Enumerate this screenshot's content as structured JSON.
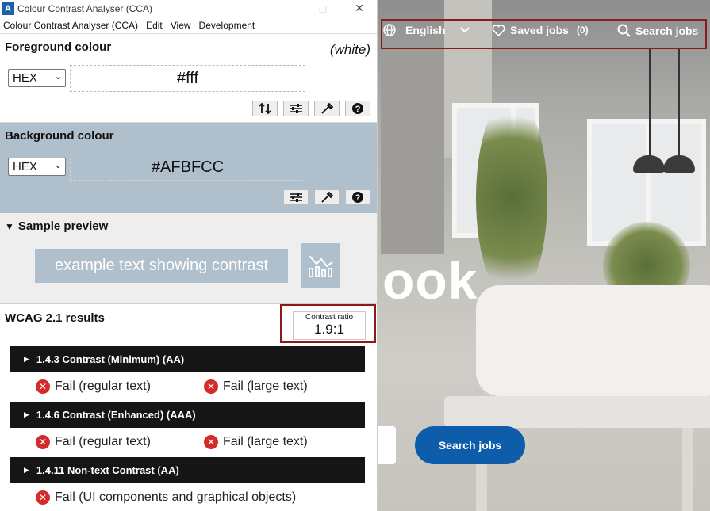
{
  "cca": {
    "title": "Colour Contrast Analyser (CCA)",
    "menu": [
      "Colour Contrast Analyser (CCA)",
      "Edit",
      "View",
      "Development"
    ],
    "foreground": {
      "title": "Foreground colour",
      "note": "(white)",
      "format": "HEX",
      "value": "#fff",
      "color": "#ffffff"
    },
    "background": {
      "title": "Background colour",
      "format": "HEX",
      "value": "#AFBFCC",
      "color": "#afbfcc"
    },
    "preview": {
      "title": "Sample preview",
      "sample_text": "example text showing contrast"
    },
    "wcag": {
      "title": "WCAG 2.1 results",
      "ratio_label": "Contrast ratio",
      "ratio_value": "1.9:1",
      "criteria": [
        {
          "label": "1.4.3 Contrast (Minimum) (AA)",
          "results": [
            "Fail (regular text)",
            "Fail (large text)"
          ]
        },
        {
          "label": "1.4.6 Contrast (Enhanced) (AAA)",
          "results": [
            "Fail (regular text)",
            "Fail (large text)"
          ]
        },
        {
          "label": "1.4.11 Non-text Contrast (AA)",
          "results": [
            "Fail (UI components and graphical objects)"
          ]
        }
      ]
    }
  },
  "site": {
    "language": "English",
    "saved_jobs": "Saved jobs",
    "saved_count": "(0)",
    "search_jobs": "Search jobs",
    "hero_text": "ook",
    "search_button": "Search jobs",
    "accent_color": "#0d5dab"
  }
}
